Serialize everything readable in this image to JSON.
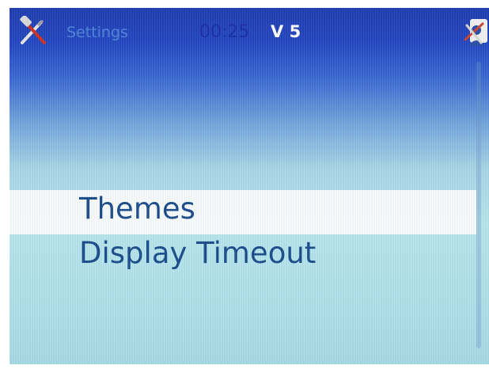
{
  "statusbar": {
    "app_icon": "settings-tools-icon",
    "title": "Settings",
    "clock": "00:25",
    "version": "V 5",
    "profile_icon": "profile-tools-icon"
  },
  "menu": {
    "items": [
      {
        "label": "Themes",
        "selected": true
      },
      {
        "label": "Display Timeout",
        "selected": false
      }
    ]
  },
  "colors": {
    "title": "#4f86d8",
    "clock": "#1b2ea8",
    "version": "#ffffff",
    "menu_text": "#1a4c8c",
    "selection": "#ffffff"
  }
}
